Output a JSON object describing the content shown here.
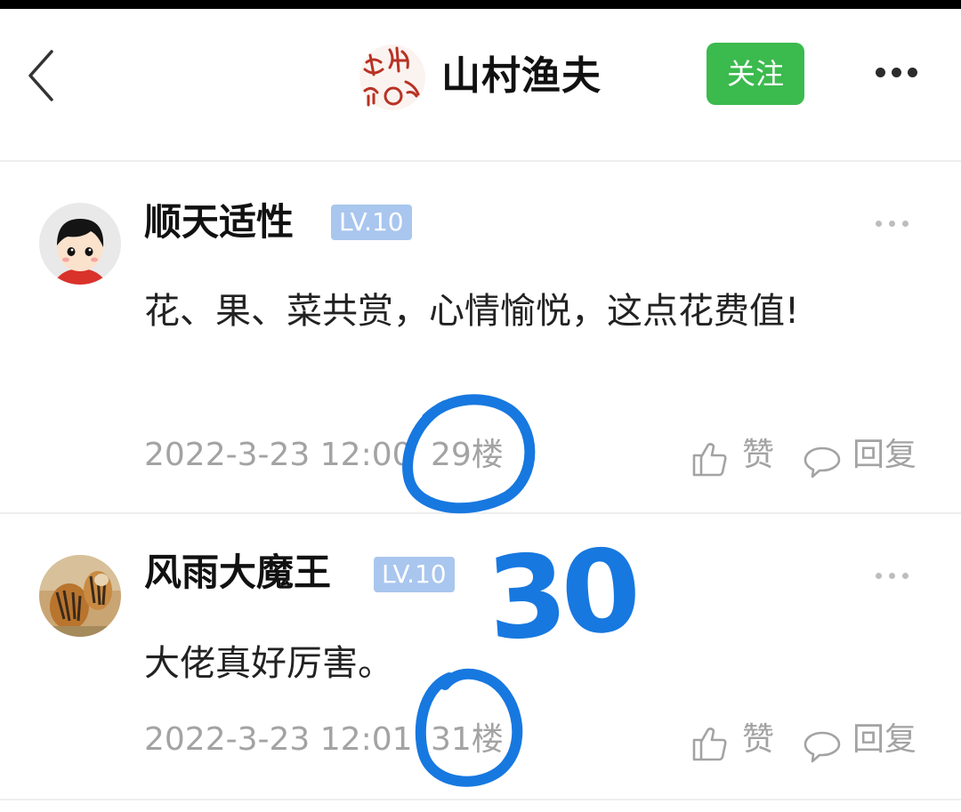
{
  "header": {
    "title": "山村渔夫",
    "follow_label": "关注",
    "seal_text": "太濑之印"
  },
  "comments": [
    {
      "username": "顺天适性",
      "level": "LV.10",
      "text": "花、果、菜共赏，心情愉悦，这点花费值!",
      "date": "2022-3-23 12:00",
      "floor": "29楼",
      "like_label": "赞",
      "reply_label": "回复"
    },
    {
      "username": "风雨大魔王",
      "level": "LV.10",
      "text": "大佬真好厉害。",
      "date": "2022-3-23 12:01",
      "floor": "31楼",
      "like_label": "赞",
      "reply_label": "回复"
    }
  ],
  "annotation": {
    "number": "30"
  },
  "colors": {
    "follow_green": "#3bba4e",
    "level_badge": "#a9c6ee",
    "annotation_blue": "#1778e0",
    "meta_gray": "#a3a3a3"
  },
  "icons": [
    "back-arrow-icon",
    "seal-logo-icon",
    "more-dots-icon",
    "thumbs-up-icon",
    "speech-bubble-icon"
  ]
}
